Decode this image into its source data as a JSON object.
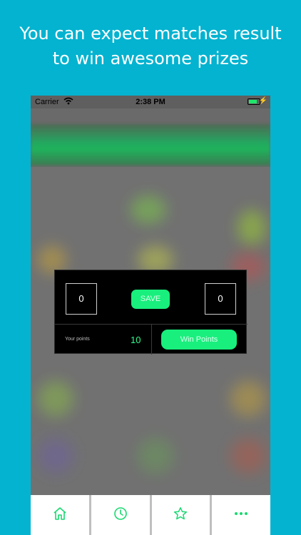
{
  "headline": {
    "line1": "You can expect matches result",
    "line2": "to win awesome prizes"
  },
  "status_bar": {
    "carrier": "Carrier",
    "time": "2:38 PM",
    "battery_level": 0.75
  },
  "dialog": {
    "home_score": "0",
    "save_label": "SAVE",
    "away_score": "0",
    "points_label": "Your points",
    "points_value": "10",
    "win_button_label": "Win Points"
  },
  "tab_bar": {
    "tabs": [
      {
        "icon": "home-icon"
      },
      {
        "icon": "clock-icon"
      },
      {
        "icon": "star-icon"
      },
      {
        "icon": "more-icon"
      }
    ]
  },
  "colors": {
    "background": "#04b3d0",
    "accent": "#18ef7d",
    "dialog_background": "#000000"
  }
}
